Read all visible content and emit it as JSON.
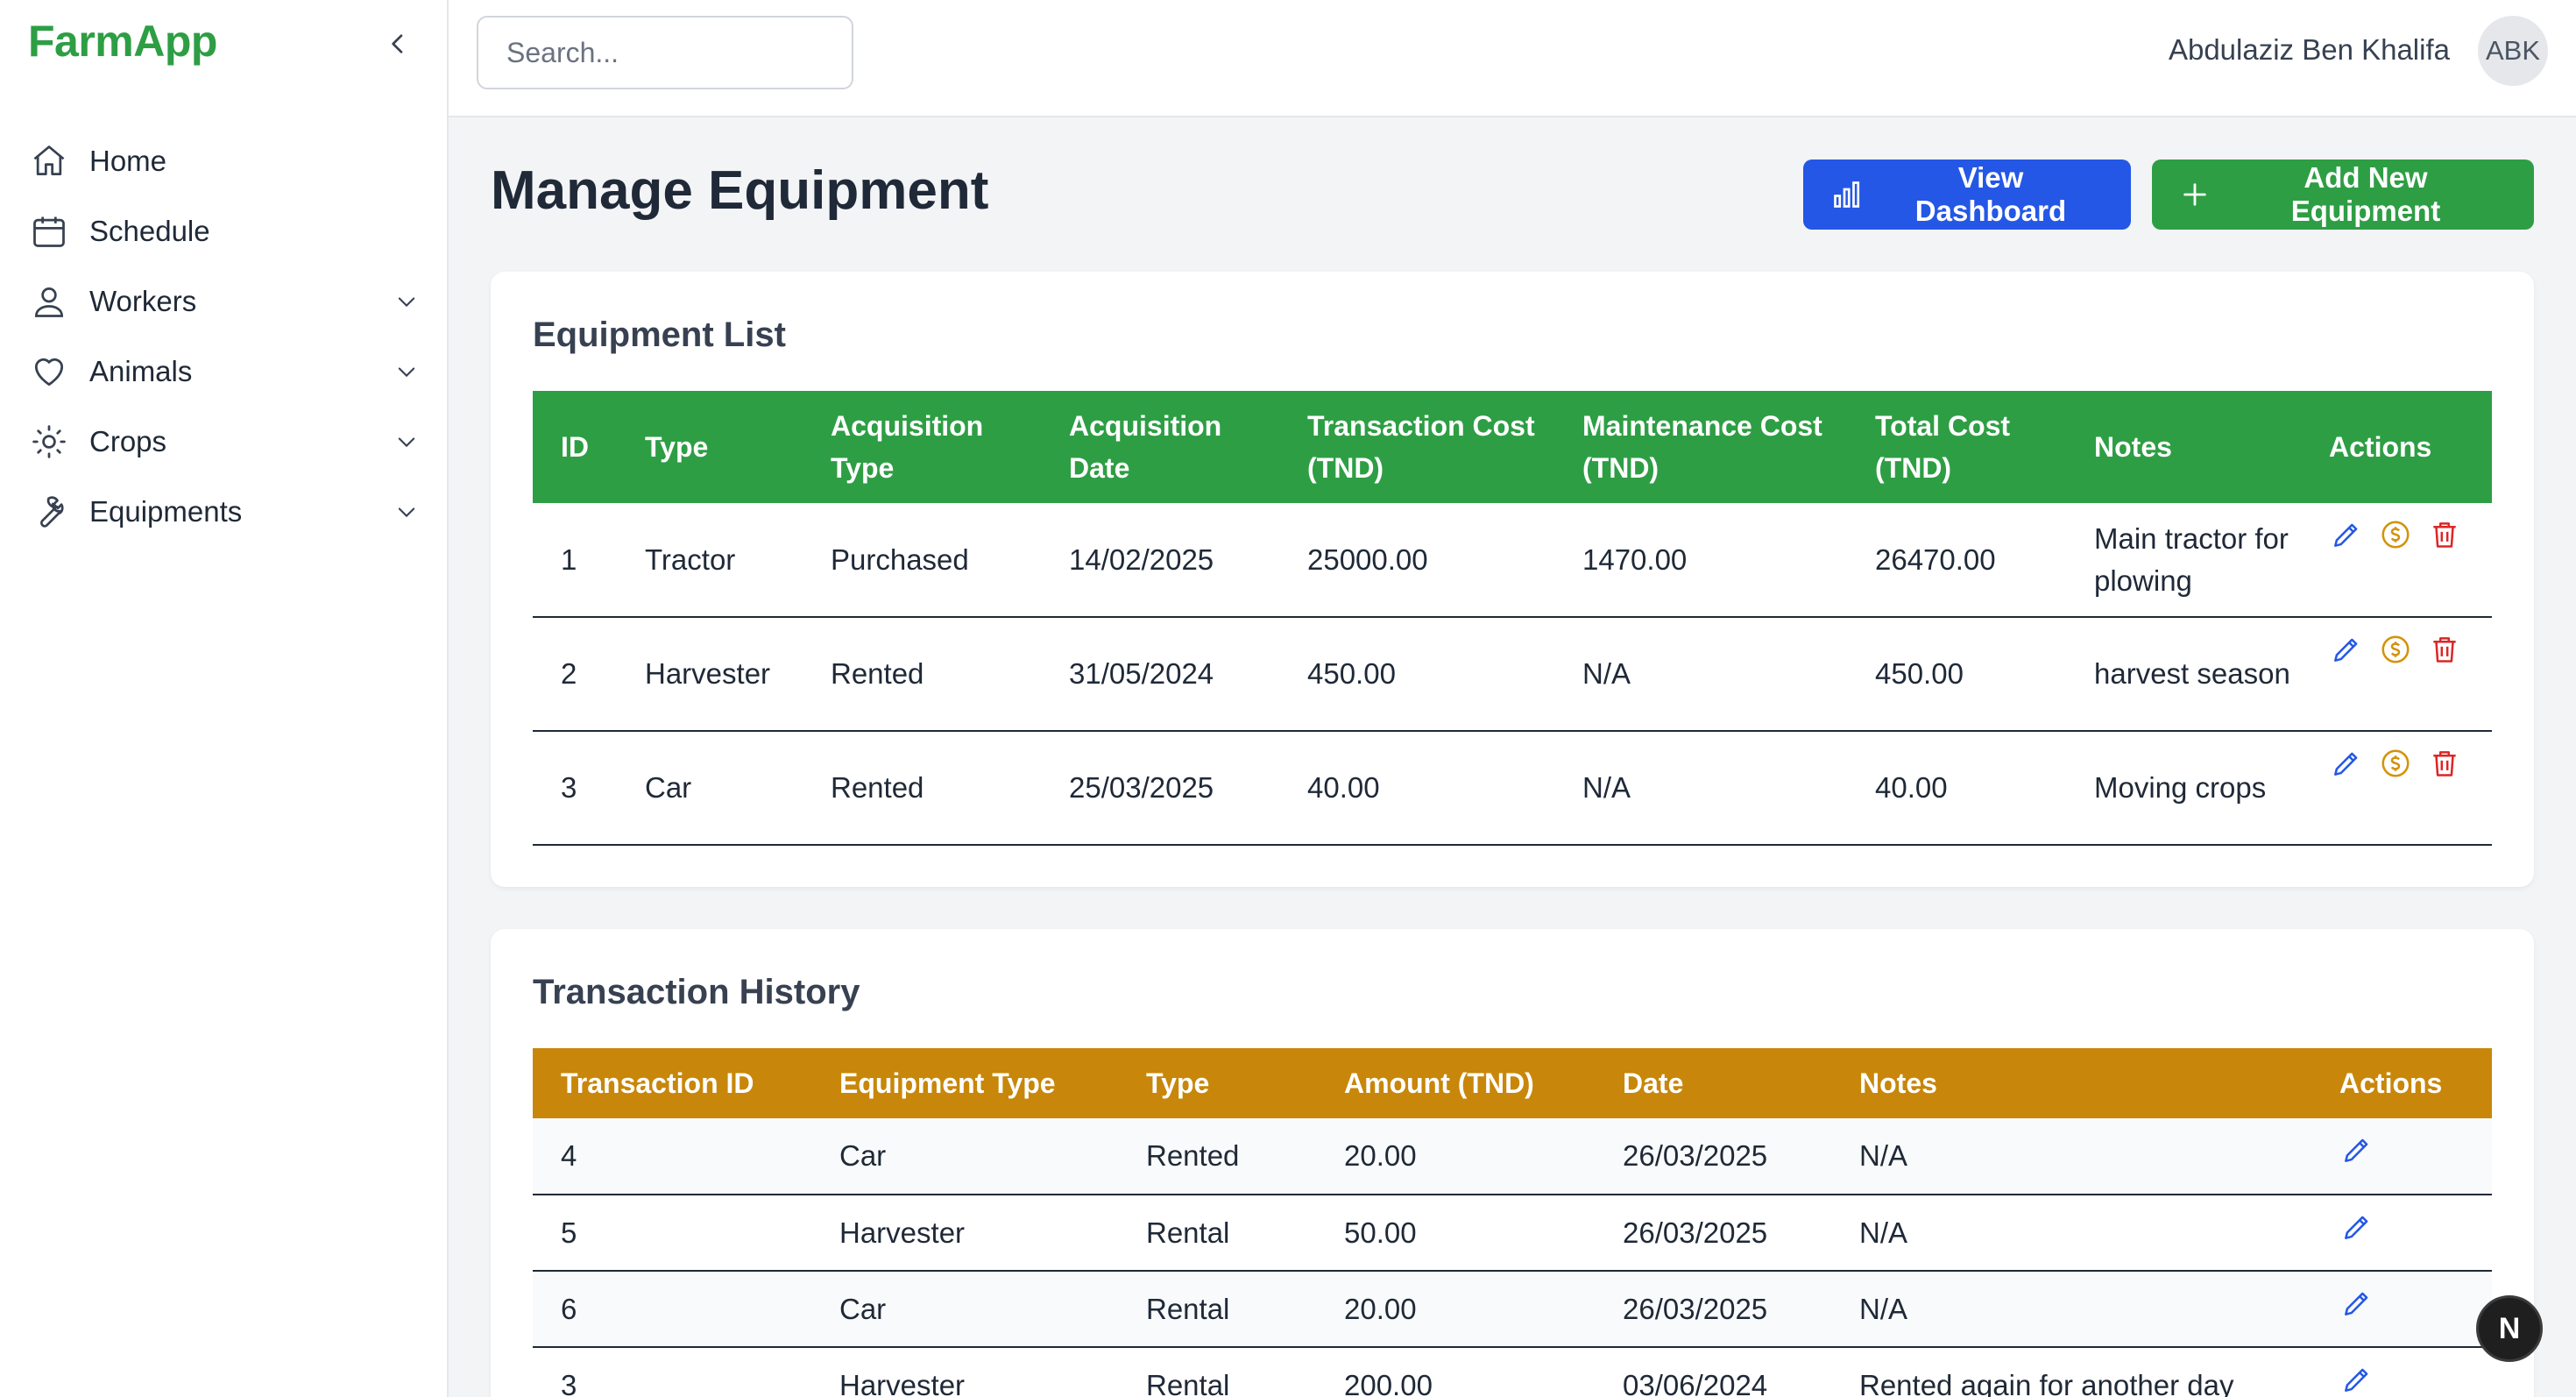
{
  "app": {
    "brand": "FarmApp"
  },
  "sidebar": {
    "items": [
      {
        "label": "Home",
        "icon": "home-icon",
        "expandable": false
      },
      {
        "label": "Schedule",
        "icon": "calendar-icon",
        "expandable": false
      },
      {
        "label": "Workers",
        "icon": "user-icon",
        "expandable": true
      },
      {
        "label": "Animals",
        "icon": "heart-icon",
        "expandable": true
      },
      {
        "label": "Crops",
        "icon": "sun-icon",
        "expandable": true
      },
      {
        "label": "Equipments",
        "icon": "wrench-icon",
        "expandable": true
      }
    ]
  },
  "topbar": {
    "search_placeholder": "Search...",
    "user_name": "Abdulaziz Ben Khalifa",
    "avatar_initials": "ABK"
  },
  "page": {
    "title": "Manage Equipment",
    "view_dashboard_label": "View Dashboard",
    "add_equipment_label": "Add New Equipment"
  },
  "equipment_list": {
    "title": "Equipment List",
    "columns": [
      "ID",
      "Type",
      "Acquisition Type",
      "Acquisition Date",
      "Transaction Cost (TND)",
      "Maintenance Cost (TND)",
      "Total Cost (TND)",
      "Notes",
      "Actions"
    ],
    "rows": [
      [
        "1",
        "Tractor",
        "Purchased",
        "14/02/2025",
        "25000.00",
        "1470.00",
        "26470.00",
        "Main tractor for plowing"
      ],
      [
        "2",
        "Harvester",
        "Rented",
        "31/05/2024",
        "450.00",
        "N/A",
        "450.00",
        "harvest season"
      ],
      [
        "3",
        "Car",
        "Rented",
        "25/03/2025",
        "40.00",
        "N/A",
        "40.00",
        "Moving crops"
      ]
    ]
  },
  "transaction_history": {
    "title": "Transaction History",
    "columns": [
      "Transaction ID",
      "Equipment Type",
      "Type",
      "Amount (TND)",
      "Date",
      "Notes",
      "Actions"
    ],
    "rows": [
      [
        "4",
        "Car",
        "Rented",
        "20.00",
        "26/03/2025",
        "N/A"
      ],
      [
        "5",
        "Harvester",
        "Rental",
        "50.00",
        "26/03/2025",
        "N/A"
      ],
      [
        "6",
        "Car",
        "Rental",
        "20.00",
        "26/03/2025",
        "N/A"
      ],
      [
        "3",
        "Harvester",
        "Rental",
        "200.00",
        "03/06/2024",
        "Rented again for another day"
      ]
    ]
  },
  "fab": {
    "label": "N"
  },
  "colors": {
    "brand_green": "#2e9e44",
    "primary_blue": "#2457e6",
    "history_header": "#c8870a",
    "edit_icon": "#2457e6",
    "payment_icon": "#d4920a",
    "delete_icon": "#dc2626"
  }
}
